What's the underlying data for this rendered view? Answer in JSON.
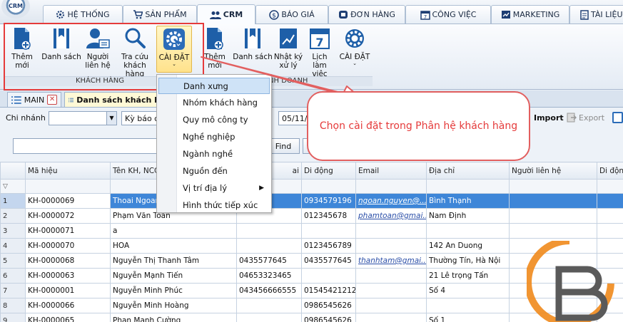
{
  "app": {
    "logo_text": "CRM"
  },
  "main_tabs": [
    {
      "label": "HỆ THỐNG",
      "icon": "settings-icon"
    },
    {
      "label": "SẢN PHẨM",
      "icon": "cart-icon"
    },
    {
      "label": "CRM",
      "icon": "users-icon",
      "active": true
    },
    {
      "label": "BÁO GIÁ",
      "icon": "dollar-icon"
    },
    {
      "label": "ĐƠN HÀNG",
      "icon": "order-icon"
    },
    {
      "label": "CÔNG VIỆC",
      "icon": "calendar-icon"
    },
    {
      "label": "MARKETING",
      "icon": "chart-icon"
    },
    {
      "label": "TÀI LIỆU",
      "icon": "document-icon"
    }
  ],
  "ribbon": {
    "khach_hang": {
      "group_label": "KHÁCH HÀNG",
      "buttons": [
        {
          "label": "Thêm mới",
          "icon": "add-document-icon"
        },
        {
          "label": "Danh sách",
          "icon": "book-icon"
        },
        {
          "label": "Người\nliên hệ",
          "icon": "contact-icon"
        },
        {
          "label": "Tra cứu\nkhách hàng",
          "icon": "search-icon"
        },
        {
          "label": "CÀI ĐẶT",
          "icon": "gear-icon",
          "selected": true
        }
      ]
    },
    "second": {
      "group_label": "KINH DOANH",
      "buttons": [
        {
          "label": "Thêm mới",
          "icon": "add-document-icon"
        },
        {
          "label": "Danh sách",
          "icon": "book-icon"
        },
        {
          "label": "Nhật ký\nxử lý",
          "icon": "line-chart-icon"
        },
        {
          "label": "Lịch làm\nviệc",
          "icon": "calendar-7-icon"
        },
        {
          "label": "CÀI ĐẶT",
          "icon": "gear-icon"
        }
      ]
    }
  },
  "doc_tabs": [
    {
      "label": "MAIN"
    },
    {
      "label": "Danh sách khách h",
      "active": true
    }
  ],
  "filter": {
    "branch_label": "Chi nhánh",
    "branch_value": "",
    "period_value": "Kỳ báo cá",
    "date_value": "05/11/",
    "import_label": "Import",
    "export_label": "Export"
  },
  "search": {
    "placeholder": "",
    "find_label": "Find"
  },
  "table": {
    "columns": [
      "",
      "Mã hiệu",
      "Tên KH, NCC",
      "",
      "Di động",
      "Email",
      "Địa chỉ",
      "Người liên hệ",
      "Di động"
    ],
    "column_partial": {
      "c3": "ai"
    },
    "rows": [
      {
        "n": "1",
        "code": "KH-0000069",
        "name": "Thoai Ngoan",
        "phone": "",
        "mobile": "0934579196",
        "email": "ngoan.nguyen@...",
        "addr": "Bình Thạnh",
        "contact": "",
        "mobile2": "",
        "selected": true
      },
      {
        "n": "2",
        "code": "KH-0000072",
        "name": "Phạm Văn Toản",
        "phone": "",
        "mobile": "012345678",
        "email": "phamtoan@gmai...",
        "addr": "Nam Định",
        "contact": "",
        "mobile2": ""
      },
      {
        "n": "3",
        "code": "KH-0000071",
        "name": "a",
        "phone": "",
        "mobile": "",
        "email": "",
        "addr": "",
        "contact": "",
        "mobile2": ""
      },
      {
        "n": "4",
        "code": "KH-0000070",
        "name": "HOA",
        "phone": "",
        "mobile": "0123456789",
        "email": "",
        "addr": "142 An Duong",
        "contact": "",
        "mobile2": ""
      },
      {
        "n": "5",
        "code": "KH-0000068",
        "name": "Nguyễn Thị Thanh Tâm",
        "phone": "0435577645",
        "mobile": "0435577645",
        "email": "thanhtam@gmai...",
        "addr": "Thường Tín, Hà Nội",
        "contact": "",
        "mobile2": ""
      },
      {
        "n": "6",
        "code": "KH-0000063",
        "name": "Nguyễn Mạnh Tiến",
        "phone": "04653323465",
        "mobile": "",
        "email": "",
        "addr": "21 Lê trọng Tấn",
        "contact": "",
        "mobile2": ""
      },
      {
        "n": "7",
        "code": "KH-0000001",
        "name": "Nguyễn Minh Phúc",
        "phone": "043456666555",
        "mobile": "01545421212",
        "email": "",
        "addr": "Số 4",
        "contact": "",
        "mobile2": ""
      },
      {
        "n": "8",
        "code": "KH-0000066",
        "name": "Nguyễn Minh Hoàng",
        "phone": "",
        "mobile": "0986545626",
        "email": "",
        "addr": "",
        "contact": "",
        "mobile2": ""
      },
      {
        "n": "9",
        "code": "KH-0000065",
        "name": "Phan Mạnh Cường",
        "phone": "",
        "mobile": "0986545626",
        "email": "",
        "addr": "Số 1",
        "contact": "",
        "mobile2": ""
      }
    ]
  },
  "dropdown_menu": [
    {
      "label": "Danh xưng",
      "highlighted": true
    },
    {
      "label": "Nhóm khách hàng"
    },
    {
      "label": "Quy mô công ty"
    },
    {
      "label": "Nghề nghiệp"
    },
    {
      "label": "Ngành nghề"
    },
    {
      "label": "Nguồn đến"
    },
    {
      "label": "Vị trí địa lý",
      "submenu": true
    },
    {
      "label": "Hình thức tiếp xúc"
    }
  ],
  "callout": {
    "text": "Chọn cài đặt trong Phân hệ khách hàng"
  },
  "colors": {
    "accent": "#3e86d8",
    "annotation_red": "#e53b3b",
    "watermark_orange": "#f08a1c"
  }
}
